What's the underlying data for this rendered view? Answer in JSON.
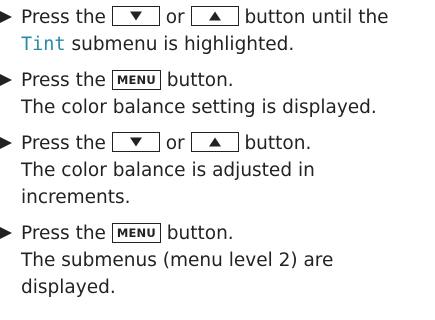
{
  "steps": [
    {
      "line1": {
        "before": "Press the",
        "key_a": "down-arrow",
        "middle": "or",
        "key_b": "up-arrow",
        "after": "button until the"
      },
      "line2": {
        "submenu": "Tint",
        "after": "submenu is highlighted."
      }
    },
    {
      "line1": {
        "before": "Press the",
        "key": "MENU",
        "after": "button."
      },
      "result": [
        "The color balance setting is displayed."
      ]
    },
    {
      "line1": {
        "before": "Press the",
        "key_a": "down-arrow",
        "middle": "or",
        "key_b": "up-arrow",
        "after": "button."
      },
      "result": [
        "The color balance is adjusted in",
        "increments."
      ]
    },
    {
      "line1": {
        "before": "Press the",
        "key": "MENU",
        "after": "button."
      },
      "result": [
        "The submenus (menu level 2) are",
        "displayed."
      ]
    }
  ],
  "colors": {
    "text": "#222222",
    "highlight": "#2a8aa8"
  }
}
